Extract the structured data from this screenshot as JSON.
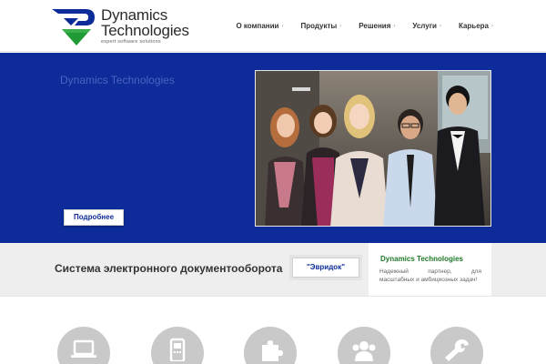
{
  "brand": {
    "name_line1": "Dynamics",
    "name_line2": "Technologies",
    "tagline": "expert software solutions",
    "colors": {
      "blue": "#0d2c9a",
      "green": "#1f9a35"
    }
  },
  "nav": {
    "items": [
      {
        "label": "О компании"
      },
      {
        "label": "Продукты"
      },
      {
        "label": "Решения"
      },
      {
        "label": "Услуги"
      },
      {
        "label": "Карьера"
      }
    ],
    "chevron": "›"
  },
  "hero": {
    "title": "Dynamics Technologies",
    "more_button": "Подробнее",
    "background": "#0d2c9a"
  },
  "banner": {
    "text": "Система электронного документооборота",
    "button": "\"Эвридок\""
  },
  "infobox": {
    "title": "Dynamics Technologies",
    "text": "Надежный партнер, для масштабных и амбициозных задач!"
  },
  "services": {
    "icons": [
      "laptop-icon",
      "mobile-phone-icon",
      "puzzle-icon",
      "users-group-icon",
      "wrench-icon"
    ]
  }
}
